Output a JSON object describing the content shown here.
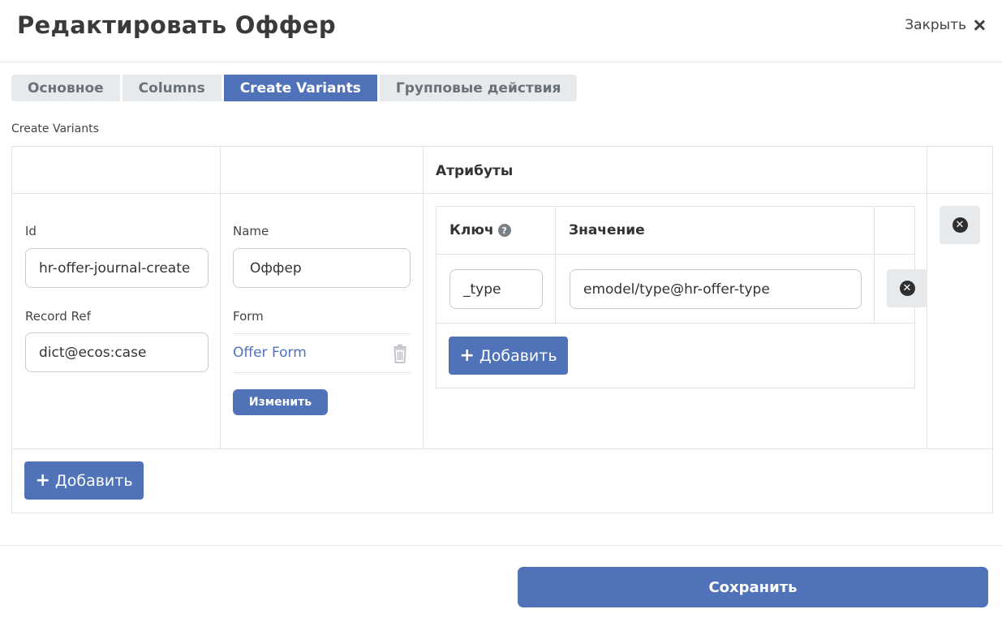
{
  "modal": {
    "title": "Редактировать Оффер",
    "close_label": "Закрыть"
  },
  "tabs": [
    {
      "label": "Основное",
      "active": false
    },
    {
      "label": "Columns",
      "active": false
    },
    {
      "label": "Create Variants",
      "active": true
    },
    {
      "label": "Групповые действия",
      "active": false
    }
  ],
  "section_label": "Create Variants",
  "table": {
    "header_attributes": "Атрибуты",
    "variant": {
      "id_label": "Id",
      "id_value": "hr-offer-journal-create",
      "record_ref_label": "Record Ref",
      "record_ref_value": "dict@ecos:case",
      "name_label": "Name",
      "name_value": "Оффер",
      "form_label": "Form",
      "form_value": "Offer Form",
      "change_button": "Изменить"
    },
    "attributes": {
      "key_header": "Ключ",
      "value_header": "Значение",
      "rows": [
        {
          "key": "_type",
          "value": "emodel/type@hr-offer-type"
        }
      ],
      "add_label": "Добавить"
    },
    "add_label": "Добавить"
  },
  "footer": {
    "save_label": "Сохранить"
  },
  "colors": {
    "accent": "#4f72b8",
    "tab_inactive": "#e7eaed"
  }
}
